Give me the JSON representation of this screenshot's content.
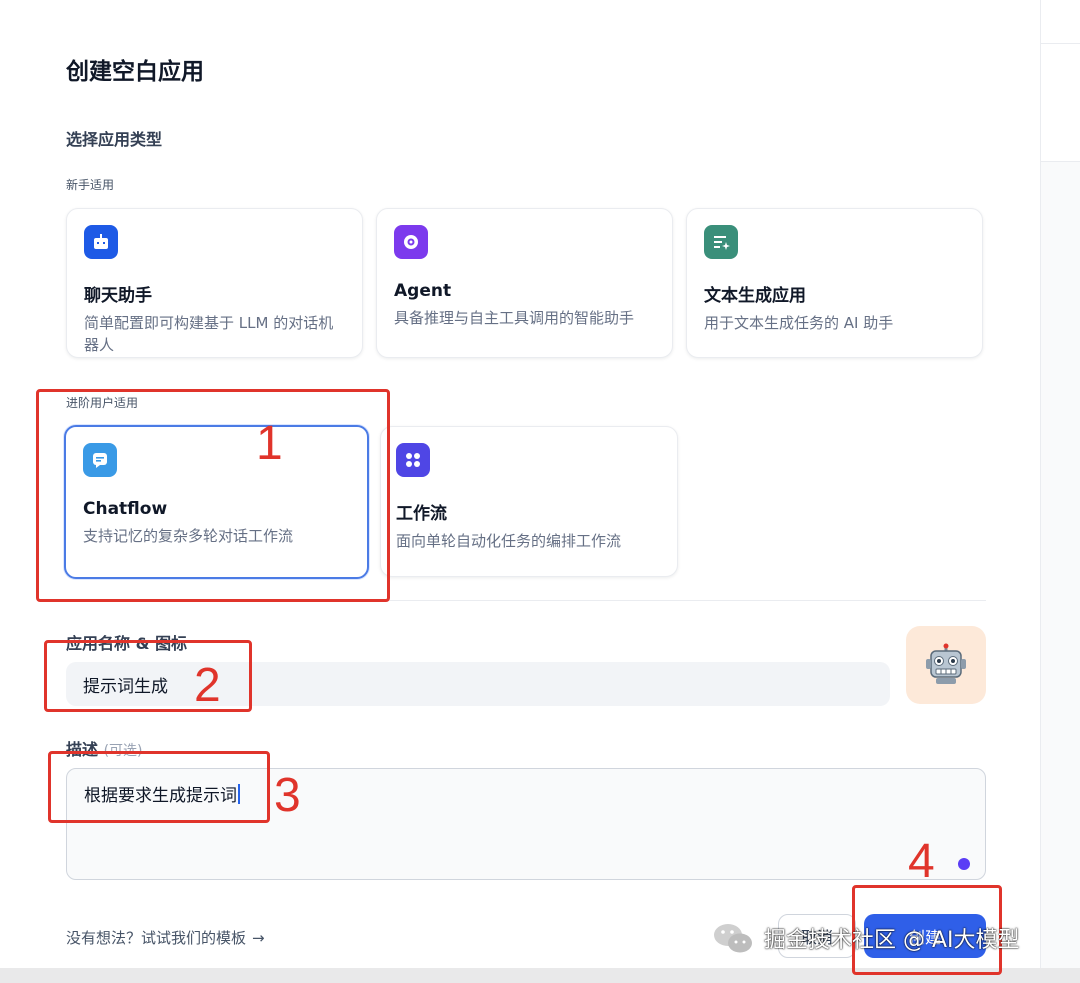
{
  "dialog": {
    "title": "创建空白应用",
    "section_title": "选择应用类型",
    "groups": [
      {
        "label": "新手适用",
        "cards": [
          {
            "name": "聊天助手",
            "desc": "简单配置即可构建基于 LLM 的对话机器人",
            "icon": "chat-bot-icon",
            "icon_color": "#1e5ae6"
          },
          {
            "name": "Agent",
            "desc": "具备推理与自主工具调用的智能助手",
            "icon": "agent-brain-icon",
            "icon_color": "#7c3aed"
          },
          {
            "name": "文本生成应用",
            "desc": "用于文本生成任务的 AI 助手",
            "icon": "text-generator-icon",
            "icon_color": "#3a8f7a"
          }
        ]
      },
      {
        "label": "进阶用户适用",
        "cards": [
          {
            "name": "Chatflow",
            "desc": "支持记忆的复杂多轮对话工作流",
            "icon": "chatflow-icon",
            "icon_color": "#3a9ae6",
            "selected": true
          },
          {
            "name": "工作流",
            "desc": "面向单轮自动化任务的编排工作流",
            "icon": "workflow-icon",
            "icon_color": "#4f46e5"
          }
        ]
      }
    ],
    "name_label": "应用名称 & 图标",
    "name_value": "提示词生成",
    "avatar_icon": "robot-emoji-icon",
    "desc_label": "描述",
    "desc_optional": "(可选)",
    "desc_value": "根据要求生成提示词",
    "template_link": "没有想法？试试我们的模板",
    "cancel_label": "取消",
    "create_label": "创建"
  },
  "annotations": [
    "1",
    "2",
    "3",
    "4"
  ],
  "watermark": "掘金技术社区 @ AI大模型",
  "colors": {
    "accent": "#2f5fe8",
    "annotation": "#e0342b",
    "selected_border": "#4b7be5"
  }
}
